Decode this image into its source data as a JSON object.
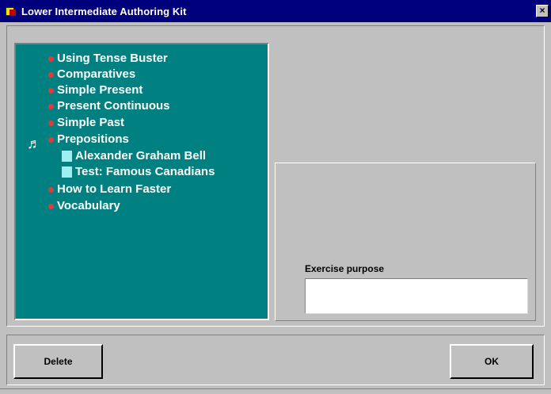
{
  "window": {
    "title": "Lower Intermediate Authoring Kit",
    "close_label": "×"
  },
  "tree": {
    "items": [
      {
        "label": "Using Tense Buster",
        "type": "folder"
      },
      {
        "label": "Comparatives",
        "type": "folder"
      },
      {
        "label": "Simple Present",
        "type": "folder"
      },
      {
        "label": "Present Continuous",
        "type": "folder"
      },
      {
        "label": "Simple Past",
        "type": "folder"
      },
      {
        "label": "Prepositions",
        "type": "folder",
        "expanded": true
      },
      {
        "label": "Alexander Graham Bell",
        "type": "exercise"
      },
      {
        "label": "Test: Famous Canadians",
        "type": "exercise"
      },
      {
        "label": "How to Learn Faster",
        "type": "folder"
      },
      {
        "label": "Vocabulary",
        "type": "folder"
      }
    ],
    "marker_glyph": "♬"
  },
  "exercise_purpose": {
    "label": "Exercise purpose",
    "value": ""
  },
  "buttons": {
    "delete": "Delete",
    "ok": "OK"
  },
  "colors": {
    "titlebar": "#00007c",
    "tree_background": "#008080",
    "bullet": "#e23a3a",
    "window": "#c0c0c0"
  }
}
